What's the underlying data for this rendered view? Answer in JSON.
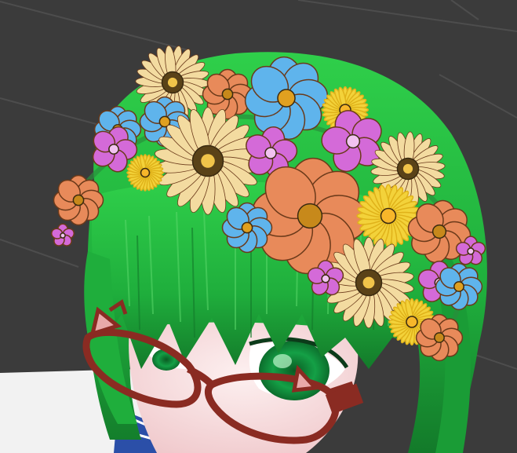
{
  "scene": {
    "subject": "3d-avatar-head-with-flower-crown",
    "colors": {
      "background": "#3b3b3b",
      "grid_line": "#4a4a4a",
      "hair": "#1fae3c",
      "hair_dark": "#137a2a",
      "hair_light": "#5ad86a",
      "skin": "#f7dede",
      "glasses": "#8a2b22",
      "eye": "#0f8a3a"
    },
    "flowers": [
      {
        "kind": "daisy",
        "color": "#f3dba0",
        "center": "#5a4218"
      },
      {
        "kind": "cosmos",
        "color": "#e88a5a",
        "center": "#c7891b"
      },
      {
        "kind": "cosmos",
        "color": "#5fb4ec",
        "center": "#e0a020"
      },
      {
        "kind": "lily",
        "color": "#d46ad8",
        "center": "#f1c2f0"
      },
      {
        "kind": "pompom",
        "color": "#f3d23a",
        "center": "#f7b62a"
      }
    ]
  }
}
